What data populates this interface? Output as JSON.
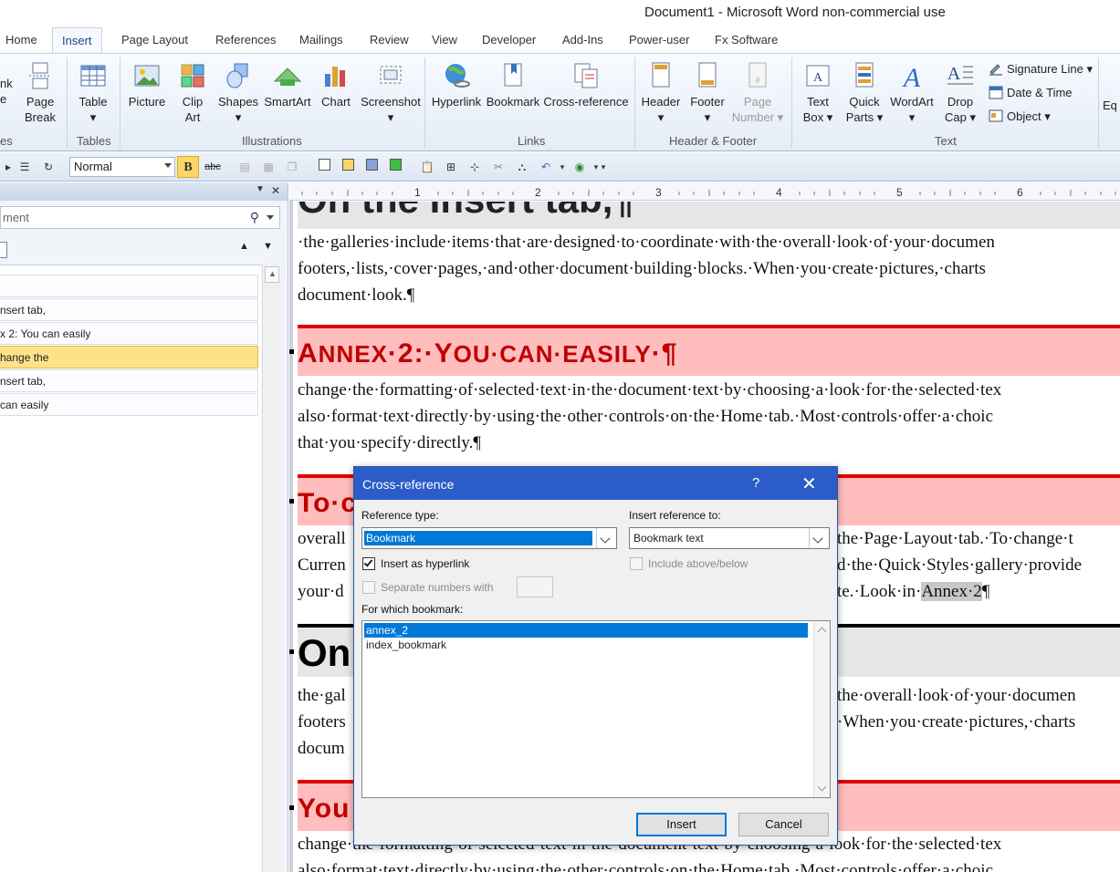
{
  "window": {
    "title": "Document1 - Microsoft Word non-commercial use"
  },
  "tabs": [
    "Home",
    "Insert",
    "Page Layout",
    "References",
    "Mailings",
    "Review",
    "View",
    "Developer",
    "Add-Ins",
    "Power-user",
    "Fx Software"
  ],
  "active_tab": "Insert",
  "ribbon": {
    "pages_group": {
      "link_partial": "nk",
      "line2_partial": "e",
      "page_break": [
        "Page",
        "Break"
      ],
      "label_partial": "es"
    },
    "tables_group": {
      "table": "Table",
      "label": "Tables"
    },
    "illustrations_group": {
      "picture": "Picture",
      "clip_art": [
        "Clip",
        "Art"
      ],
      "shapes": "Shapes",
      "smartart": "SmartArt",
      "chart": "Chart",
      "screenshot": "Screenshot",
      "label": "Illustrations"
    },
    "links_group": {
      "hyperlink": "Hyperlink",
      "bookmark": "Bookmark",
      "cross_reference": "Cross-reference",
      "label": "Links"
    },
    "header_footer_group": {
      "header": "Header",
      "footer": "Footer",
      "page_number": [
        "Page",
        "Number"
      ],
      "label": "Header & Footer"
    },
    "text_group": {
      "text_box": [
        "Text",
        "Box"
      ],
      "quick_parts": [
        "Quick",
        "Parts"
      ],
      "wordart": "WordArt",
      "drop_cap": [
        "Drop",
        "Cap"
      ],
      "signature_line": "Signature Line",
      "date_time": "Date & Time",
      "object": "Object",
      "label": "Text"
    },
    "equation_partial": "Eq"
  },
  "quick_toolbar": {
    "style_value": "Normal",
    "bold": "B",
    "strike": "abc"
  },
  "nav_pane": {
    "search_text": "ment",
    "items": [
      {
        "label": ""
      },
      {
        "label": "nsert tab,"
      },
      {
        "label": "x 2: You can easily"
      },
      {
        "label": "hange the",
        "selected": true
      },
      {
        "label": "nsert tab,"
      },
      {
        "label": "can easily"
      }
    ]
  },
  "ruler": {
    "numbers": [
      "1",
      "2",
      "3",
      "4",
      "5",
      "6"
    ]
  },
  "document": {
    "heading_top_partial": "On the Insert tab,¶",
    "para1": [
      "·the·galleries·include·items·that·are·designed·to·coordinate·with·the·overall·look·of·your·documen",
      "footers,·lists,·cover·pages,·and·other·document·building·blocks.·When·you·create·pictures,·charts",
      "document·look.¶"
    ],
    "heading_annex": {
      "prefix": "A",
      "rest1": "NNEX",
      "mid": "·2:·Y",
      "rest2": "OU·CAN·EASILY",
      "end": "·¶"
    },
    "para2": [
      "change·the·formatting·of·selected·text·in·the·document·text·by·choosing·a·look·for·the·selected·tex",
      "also·format·text·directly·by·using·the·other·controls·on·the·Home·tab.·Most·controls·offer·a·choic",
      "that·you·specify·directly.¶"
    ],
    "heading_to_partial": "To·c",
    "para3_left": [
      "overall",
      "Curren",
      "your·d"
    ],
    "para3_right": [
      "the·Page·Layout·tab.·To·change·t",
      "d·the·Quick·Styles·gallery·provide",
      "te.·Look·in·"
    ],
    "para3_annex_ref": "Annex·2",
    "para3_pilcrow": "¶",
    "heading_on_partial": "On",
    "para4_left": [
      "the·gal",
      "footers",
      "docum"
    ],
    "para4_right": [
      "the·overall·look·of·your·documen",
      "·When·you·create·pictures,·charts"
    ],
    "heading_you_partial": "You",
    "para5_lines": [
      "change·the·formatting·of·selected·text·in·the·document·text·by·choosing·a·look·for·the·selected·tex",
      "also·format·text·directly·by·using·the·other·controls·on·the·Home·tab.·Most·controls·offer·a·choic"
    ]
  },
  "dialog": {
    "title": "Cross-reference",
    "help": "?",
    "close": "✕",
    "reference_type_label": "Reference type:",
    "reference_type_value": "Bookmark",
    "insert_reference_label": "Insert reference to:",
    "insert_reference_value": "Bookmark text",
    "insert_as_hyperlink_label": "Insert as hyperlink",
    "insert_as_hyperlink_checked": true,
    "include_above_below_label": "Include above/below",
    "separate_numbers_label": "Separate numbers with",
    "for_which_label": "For which bookmark:",
    "bookmarks": [
      {
        "name": "annex_2",
        "selected": true
      },
      {
        "name": "index_bookmark",
        "selected": false
      }
    ],
    "insert_button": "Insert",
    "cancel_button": "Cancel"
  },
  "colors": {
    "accent": "#2b5cc8",
    "heading_red": "#c00000",
    "heading_bg": "#ffbdbd",
    "selection": "#0078d7",
    "nav_selected": "#fde28a"
  }
}
